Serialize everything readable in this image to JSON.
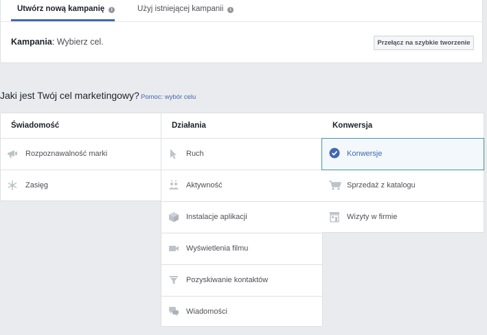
{
  "tabs": [
    {
      "label": "Utwórz nową kampanię",
      "info": "i"
    },
    {
      "label": "Użyj istniejącej kampanii",
      "info": "i"
    }
  ],
  "campaign": {
    "label": "Kampania",
    "separator": ":",
    "value": " Wybierz cel."
  },
  "switch_button": "Przełącz na szybkie tworzenie",
  "question": "Jaki jest Twój cel marketingowy?",
  "help_link": "Pomoc: wybór celu",
  "columns": [
    {
      "title": "Świadomość",
      "items": [
        {
          "label": "Rozpoznawalność marki",
          "icon": "megaphone-icon"
        },
        {
          "label": "Zasięg",
          "icon": "snowflake-icon"
        }
      ]
    },
    {
      "title": "Działania",
      "items": [
        {
          "label": "Ruch",
          "icon": "cursor-icon"
        },
        {
          "label": "Aktywność",
          "icon": "people-icon"
        },
        {
          "label": "Instalacje aplikacji",
          "icon": "box-icon"
        },
        {
          "label": "Wyświetlenia filmu",
          "icon": "video-icon"
        },
        {
          "label": "Pozyskiwanie kontaktów",
          "icon": "funnel-icon"
        },
        {
          "label": "Wiadomości",
          "icon": "chat-icon"
        }
      ]
    },
    {
      "title": "Konwersja",
      "items": [
        {
          "label": "Konwersje",
          "icon": "check-circle-icon",
          "selected": true
        },
        {
          "label": "Sprzedaż z katalogu",
          "icon": "cart-icon"
        },
        {
          "label": "Wizyty w firmie",
          "icon": "store-icon"
        }
      ]
    }
  ],
  "colors": {
    "accent": "#4267b2",
    "selected_border": "#4a90a4",
    "selected_bg": "#f2f8fb",
    "icon": "#bec2c9"
  }
}
